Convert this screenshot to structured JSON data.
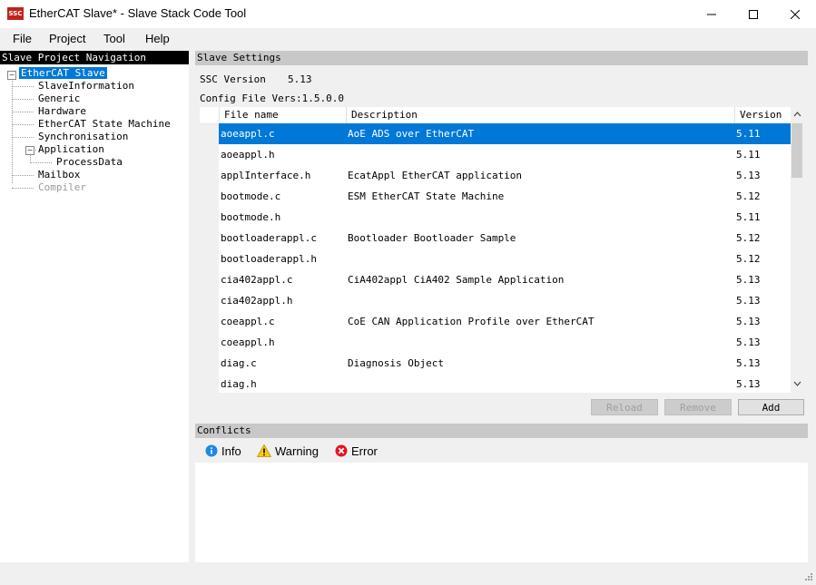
{
  "window": {
    "title": "EtherCAT Slave* - Slave Stack Code Tool",
    "app_icon_text": "SSC",
    "controls": [
      "minimize",
      "maximize",
      "close"
    ]
  },
  "menu": {
    "file": "File",
    "project": "Project",
    "tool": "Tool",
    "help": "Help"
  },
  "navigation": {
    "header": "Slave Project Navigation",
    "items": [
      {
        "label": "EtherCAT Slave",
        "selected": true
      },
      {
        "label": "SlaveInformation"
      },
      {
        "label": "Generic"
      },
      {
        "label": "Hardware"
      },
      {
        "label": "EtherCAT State Machine"
      },
      {
        "label": "Synchronisation"
      },
      {
        "label": "Application"
      },
      {
        "label": "ProcessData"
      },
      {
        "label": "Mailbox"
      },
      {
        "label": "Compiler",
        "disabled": true
      }
    ]
  },
  "settings": {
    "header": "Slave Settings",
    "ssc_version_label": "SSC Version",
    "ssc_version_value": "5.13",
    "config_file_label": "Config File Vers:1.5.0.0"
  },
  "file_table": {
    "columns": {
      "name": "File name",
      "description": "Description",
      "version": "Version"
    },
    "rows": [
      {
        "name": "aoeappl.c",
        "description": "AoE ADS over EtherCAT",
        "version": "5.11",
        "selected": true
      },
      {
        "name": "aoeappl.h",
        "description": "",
        "version": "5.11"
      },
      {
        "name": "applInterface.h",
        "description": "EcatAppl EtherCAT application",
        "version": "5.13"
      },
      {
        "name": "bootmode.c",
        "description": "ESM EtherCAT State Machine",
        "version": "5.12"
      },
      {
        "name": "bootmode.h",
        "description": "",
        "version": "5.11"
      },
      {
        "name": "bootloaderappl.c",
        "description": "Bootloader Bootloader Sample",
        "version": "5.12"
      },
      {
        "name": "bootloaderappl.h",
        "description": "",
        "version": "5.12"
      },
      {
        "name": "cia402appl.c",
        "description": "CiA402appl CiA402 Sample Application",
        "version": "5.13"
      },
      {
        "name": "cia402appl.h",
        "description": "",
        "version": "5.13"
      },
      {
        "name": "coeappl.c",
        "description": "CoE CAN Application Profile over EtherCAT",
        "version": "5.13"
      },
      {
        "name": "coeappl.h",
        "description": "",
        "version": "5.13"
      },
      {
        "name": "diag.c",
        "description": "Diagnosis Object",
        "version": "5.13"
      },
      {
        "name": "diag.h",
        "description": "",
        "version": "5.13"
      }
    ]
  },
  "buttons": {
    "reload": "Reload",
    "remove": "Remove",
    "add": "Add"
  },
  "conflicts": {
    "header": "Conflicts",
    "tabs": {
      "info": "Info",
      "warning": "Warning",
      "error": "Error"
    }
  },
  "colors": {
    "selection": "#0078d7",
    "panel_header": "#c8c8c8",
    "error_red": "#e81123",
    "warning_yellow": "#ffcc00",
    "info_blue": "#1e88e5"
  }
}
